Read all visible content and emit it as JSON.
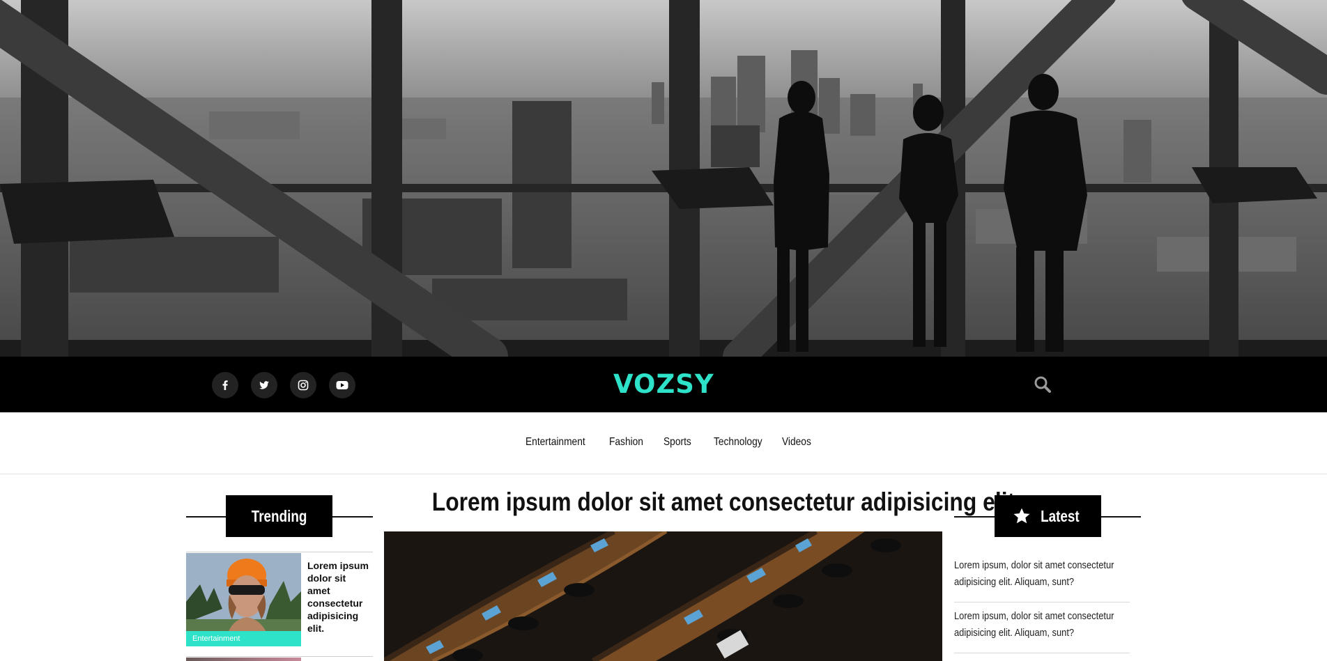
{
  "header": {
    "logo": "VOZSY",
    "social": [
      {
        "icon": "facebook-icon"
      },
      {
        "icon": "twitter-icon"
      },
      {
        "icon": "instagram-icon"
      },
      {
        "icon": "youtube-icon"
      }
    ],
    "search_icon": "search-icon"
  },
  "nav": {
    "items": [
      "Entertainment",
      "Fashion",
      "Sports",
      "Technology",
      "Videos"
    ]
  },
  "trending": {
    "heading": "Trending",
    "items": [
      {
        "title": "Lorem ipsum dolor sit amet consectetur adipisicing elit.",
        "category": "Entertainment"
      }
    ]
  },
  "main": {
    "title": "Lorem ipsum dolor sit amet consectetur adipisicing elit."
  },
  "latest": {
    "heading": "Latest",
    "icon": "star-icon",
    "items": [
      "Lorem ipsum, dolor sit amet consectetur adipisicing elit. Aliquam, sunt?",
      "Lorem ipsum, dolor sit amet consectetur adipisicing elit. Aliquam, sunt?"
    ]
  },
  "colors": {
    "accent": "#2de2c8",
    "bar": "#000000",
    "text": "#111111"
  }
}
